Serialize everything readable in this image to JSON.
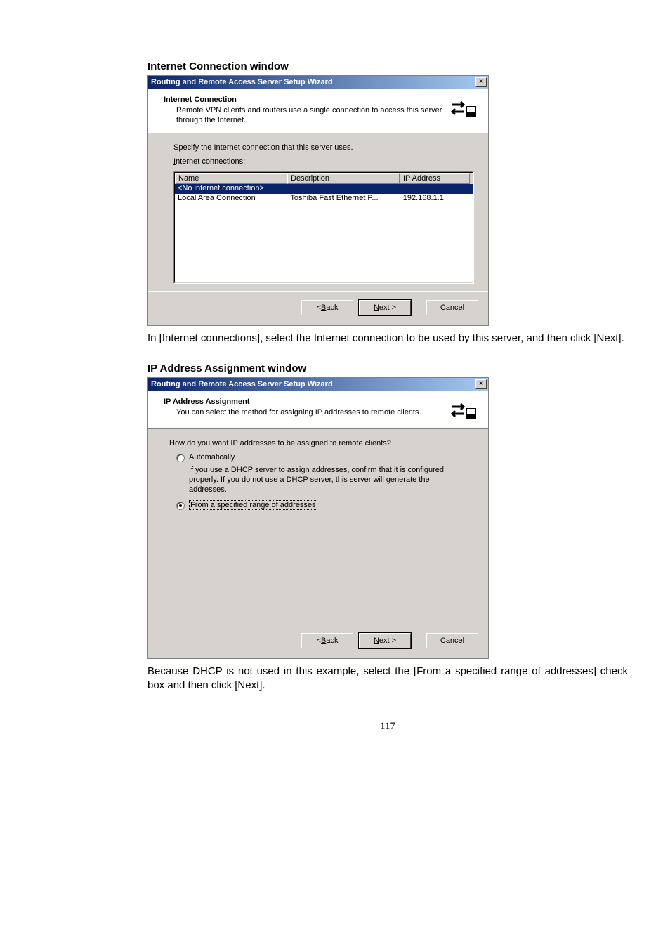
{
  "section1": {
    "heading": "Internet Connection window"
  },
  "dialog1": {
    "title": "Routing and Remote Access Server Setup Wizard",
    "close": "×",
    "header_title": "Internet Connection",
    "header_sub": "Remote VPN clients and routers use a single connection to access this server through the Internet.",
    "icon": "↔️",
    "specify_text": "Specify the Internet connection that this server uses.",
    "connections_label_pre": "I",
    "connections_label_rest": "nternet connections:",
    "columns": {
      "name": "Name",
      "description": "Description",
      "ip": "IP Address"
    },
    "rows": [
      {
        "name": "<No internet connection>",
        "description": "",
        "ip": "",
        "selected": true
      },
      {
        "name": "Local Area Connection",
        "description": "Toshiba Fast Ethernet P...",
        "ip": "192.168.1.1",
        "selected": false
      }
    ],
    "buttons": {
      "back_pre": "< ",
      "back_u": "B",
      "back_rest": "ack",
      "next_u": "N",
      "next_rest": "ext >",
      "cancel": "Cancel"
    }
  },
  "para1": "In [Internet connections], select the Internet connection to be used by this server, and then click [Next].",
  "section2": {
    "heading": "IP Address Assignment window"
  },
  "dialog2": {
    "title": "Routing and Remote Access Server Setup Wizard",
    "close": "×",
    "header_title": "IP Address Assignment",
    "header_sub": "You can select the method for assigning IP addresses to remote clients.",
    "icon": "↔️",
    "question": "How do you want IP addresses to be assigned to remote clients?",
    "radio_auto_u": "A",
    "radio_auto_rest": "utomatically",
    "auto_note": "If you use a DHCP server to assign addresses, confirm that it is configured properly. If you do not use a DHCP server, this server will generate the addresses.",
    "radio_range_u": "F",
    "radio_range_rest": "rom a specified range of addresses",
    "buttons": {
      "back_pre": "< ",
      "back_u": "B",
      "back_rest": "ack",
      "next_u": "N",
      "next_rest": "ext >",
      "cancel": "Cancel"
    }
  },
  "para2": "Because DHCP is not used in this example, select the [From a specified range of addresses] check box and then click [Next].",
  "page_number": "117"
}
